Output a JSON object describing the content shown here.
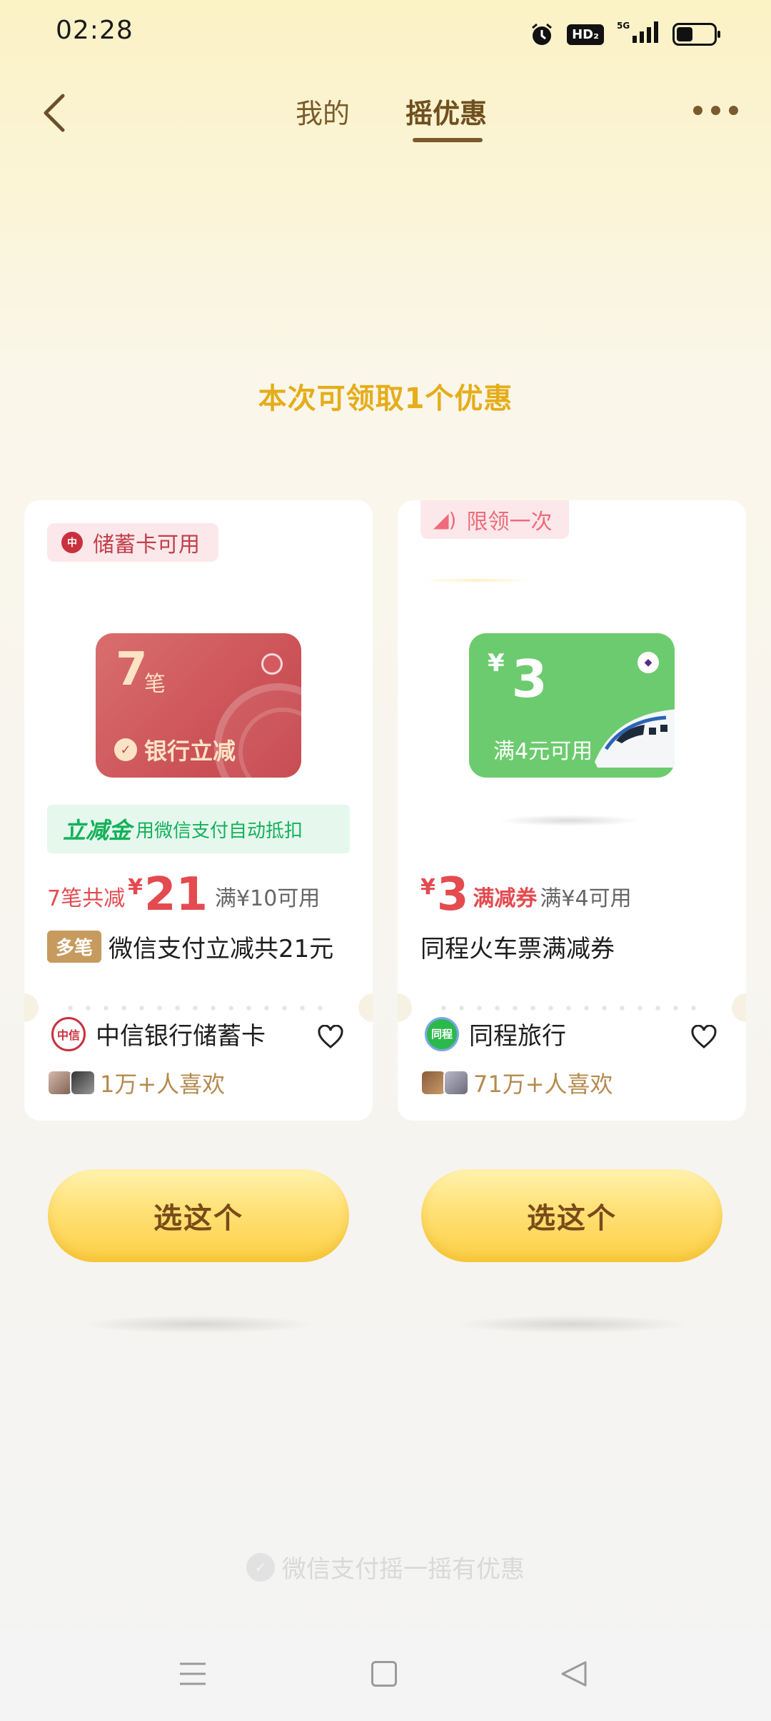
{
  "status": {
    "time": "02:28",
    "hd": "HD₂",
    "signal": "⁵ᴳ"
  },
  "nav": {
    "tabs": [
      {
        "label": "我的"
      },
      {
        "label": "摇优惠"
      }
    ]
  },
  "headline": "本次可领取1个优惠",
  "cards": [
    {
      "badge": "储蓄卡可用",
      "visual": {
        "count": "7",
        "unit": "笔",
        "label": "银行立减"
      },
      "banner": {
        "title": "立减金",
        "text": "用微信支付自动抵扣"
      },
      "price": {
        "lead": "7笔共减",
        "yen": "¥",
        "amount": "21",
        "condition": "满¥10可用"
      },
      "tag": "多笔",
      "desc": "微信支付立减共21元",
      "merchant": "中信银行储蓄卡",
      "likes": "1万+人喜欢",
      "button": "选这个"
    },
    {
      "badge": "限领一次",
      "visual": {
        "yen": "¥",
        "amount": "3",
        "condition": "满4元可用"
      },
      "price": {
        "yen": "¥",
        "amount": "3",
        "type": "满减券",
        "condition": "满¥4可用"
      },
      "desc": "同程火车票满减券",
      "merchant": "同程旅行",
      "likes": "71万+人喜欢",
      "button": "选这个"
    }
  ],
  "footer": "微信支付摇一摇有优惠",
  "colors": {
    "accent": "#e5ad1a",
    "price": "#e34b50",
    "wechat_green": "#14b15a",
    "button": "#fcd047"
  }
}
